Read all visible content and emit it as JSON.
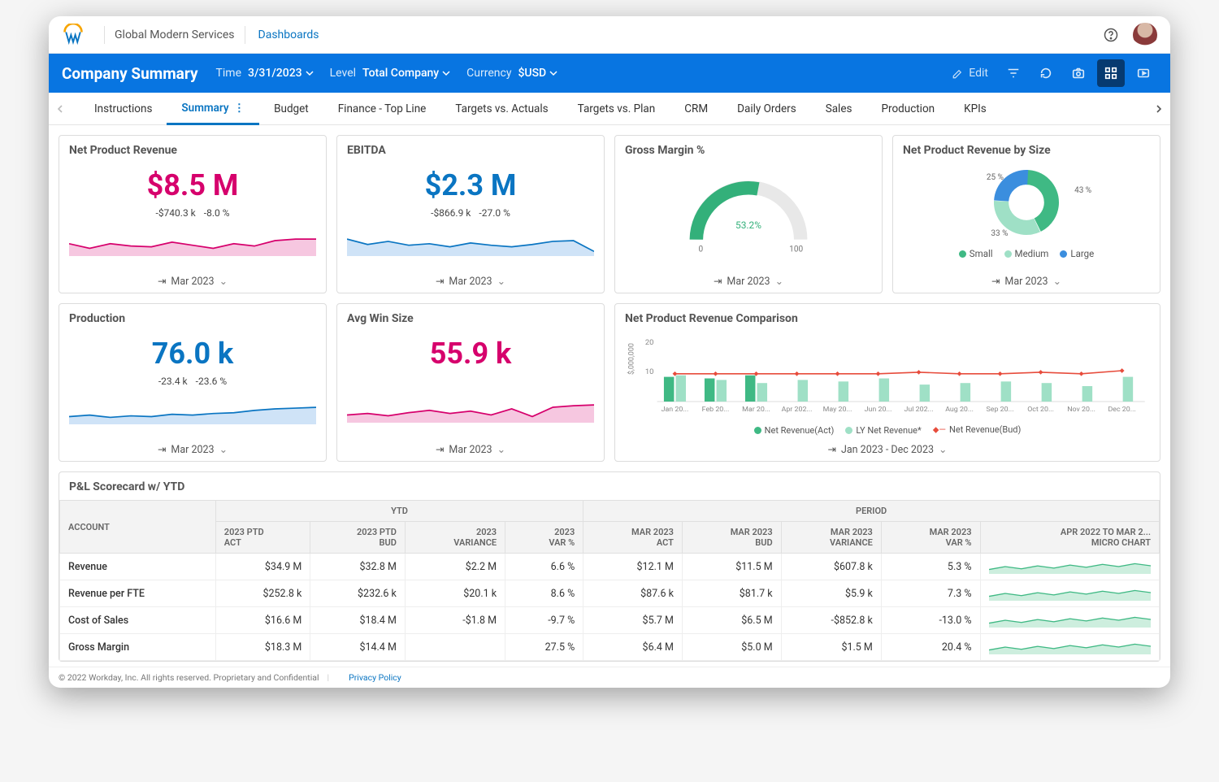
{
  "header": {
    "company": "Global Modern Services",
    "crumbLink": "Dashboards"
  },
  "bluebar": {
    "title": "Company Summary",
    "filters": {
      "time": {
        "label": "Time",
        "value": "3/31/2023"
      },
      "level": {
        "label": "Level",
        "value": "Total Company"
      },
      "currency": {
        "label": "Currency",
        "value": "$USD"
      }
    },
    "edit": "Edit"
  },
  "tabs": [
    "Instructions",
    "Summary",
    "Budget",
    "Finance - Top Line",
    "Targets vs. Actuals",
    "Targets vs. Plan",
    "CRM",
    "Daily Orders",
    "Sales",
    "Production",
    "KPIs"
  ],
  "activeTab": 1,
  "metrics": {
    "netProductRevenue": {
      "title": "Net Product Revenue",
      "value": "$8.5 M",
      "deltaAbs": "-$740.3 k",
      "deltaPct": "-8.0 %",
      "period": "Mar 2023"
    },
    "ebitda": {
      "title": "EBITDA",
      "value": "$2.3 M",
      "deltaAbs": "-$866.9 k",
      "deltaPct": "-27.0 %",
      "period": "Mar 2023"
    },
    "grossMargin": {
      "title": "Gross Margin %",
      "value": "53.2%",
      "scaleMin": "0",
      "scaleMax": "100",
      "period": "Mar 2023"
    },
    "bySize": {
      "title": "Net Product Revenue by Size",
      "period": "Mar 2023",
      "legend": [
        "Small",
        "Medium",
        "Large"
      ],
      "labels": {
        "small": "43 %",
        "medium": "33 %",
        "large": "25 %"
      }
    },
    "production": {
      "title": "Production",
      "value": "76.0 k",
      "deltaAbs": "-23.4 k",
      "deltaPct": "-23.6 %",
      "period": "Mar 2023"
    },
    "avgWin": {
      "title": "Avg Win Size",
      "value": "55.9 k",
      "period": "Mar 2023"
    },
    "comparison": {
      "title": "Net Product Revenue Comparison",
      "period": "Jan 2023 - Dec 2023",
      "yLabel": "$,000,000",
      "yTicks": [
        "20",
        "10"
      ],
      "legend": [
        "Net Revenue(Act)",
        "LY Net Revenue*",
        "Net Revenue(Bud)"
      ]
    }
  },
  "table": {
    "title": "P&L Scorecard w/ YTD",
    "groupHeaders": {
      "account": "ACCOUNT",
      "ytd": "YTD",
      "period": "PERIOD"
    },
    "cols": {
      "ytdAct": "2023 PTD\nACT",
      "ytdBud": "2023 PTD\nBUD",
      "ytdVar": "2023\nVARIANCE",
      "ytdVarPct": "2023\nVAR %",
      "pAct": "MAR 2023\nACT",
      "pBud": "MAR 2023\nBUD",
      "pVar": "MAR 2023\nVARIANCE",
      "pVarPct": "MAR 2023\nVAR %",
      "micro": "APR 2022 TO MAR 2...\nMICRO CHART"
    },
    "rows": [
      {
        "acct": "Revenue",
        "ytdAct": "$34.9 M",
        "ytdBud": "$32.8 M",
        "ytdVar": "$2.2 M",
        "ytdVarPct": "6.6 %",
        "pAct": "$12.1 M",
        "pBud": "$11.5 M",
        "pVar": "$607.8 k",
        "pVarPct": "5.3 %"
      },
      {
        "acct": "Revenue per FTE",
        "ytdAct": "$252.8 k",
        "ytdBud": "$232.6 k",
        "ytdVar": "$20.1 k",
        "ytdVarPct": "8.6 %",
        "pAct": "$87.6 k",
        "pBud": "$81.7 k",
        "pVar": "$5.9 k",
        "pVarPct": "7.3 %"
      },
      {
        "acct": "Cost of Sales",
        "ytdAct": "$16.6 M",
        "ytdBud": "$18.4 M",
        "ytdVar": "-$1.8 M",
        "ytdVarPct": "-9.7 %",
        "pAct": "$5.7 M",
        "pBud": "$6.5 M",
        "pVar": "-$852.8 k",
        "pVarPct": "-13.0 %"
      },
      {
        "acct": "Gross Margin",
        "ytdAct": "$18.3 M",
        "ytdBud": "$14.4 M",
        "ytdVar": "",
        "ytdVarPct": "27.5 %",
        "pAct": "$6.4 M",
        "pBud": "$5.0 M",
        "pVar": "$1.5 M",
        "pVarPct": "20.4 %"
      }
    ]
  },
  "footer": {
    "copyright": "© 2022 Workday, Inc. All rights reserved. Proprietary and Confidential",
    "privacy": "Privacy Policy"
  },
  "chart_data": [
    {
      "type": "area",
      "title": "Net Product Revenue spark",
      "x": [
        1,
        2,
        3,
        4,
        5,
        6,
        7,
        8,
        9,
        10,
        11,
        12
      ],
      "values": [
        8.6,
        8.0,
        8.5,
        8.3,
        8.2,
        8.8,
        8.4,
        8.0,
        8.6,
        8.3,
        9.0,
        9.2
      ]
    },
    {
      "type": "area",
      "title": "EBITDA spark",
      "x": [
        1,
        2,
        3,
        4,
        5,
        6,
        7,
        8,
        9,
        10,
        11,
        12
      ],
      "values": [
        3.0,
        2.5,
        2.8,
        2.4,
        2.6,
        2.3,
        2.7,
        2.5,
        2.4,
        2.6,
        2.9,
        1.6
      ]
    },
    {
      "type": "gauge",
      "title": "Gross Margin %",
      "value": 53.2,
      "min": 0,
      "max": 100
    },
    {
      "type": "pie",
      "title": "Net Product Revenue by Size",
      "categories": [
        "Small",
        "Medium",
        "Large"
      ],
      "values": [
        43,
        33,
        25
      ]
    },
    {
      "type": "area",
      "title": "Production spark",
      "x": [
        1,
        2,
        3,
        4,
        5,
        6,
        7,
        8,
        9,
        10,
        11,
        12
      ],
      "values": [
        70,
        72,
        69,
        71,
        70,
        73,
        72,
        74,
        75,
        78,
        80,
        82
      ]
    },
    {
      "type": "area",
      "title": "Avg Win Size spark",
      "x": [
        1,
        2,
        3,
        4,
        5,
        6,
        7,
        8,
        9,
        10,
        11,
        12
      ],
      "values": [
        50,
        52,
        49,
        53,
        56,
        52,
        55,
        50,
        58,
        48,
        60,
        62
      ]
    },
    {
      "type": "bar",
      "title": "Net Product Revenue Comparison",
      "ylabel": "$,000,000",
      "ylim": [
        0,
        20
      ],
      "categories": [
        "Jan 20...",
        "Feb 20...",
        "Mar 20...",
        "Apr 202...",
        "May 20...",
        "Jun 20...",
        "Jul 202...",
        "Aug 20...",
        "Sep 20...",
        "Oct 20...",
        "Nov 20...",
        "Dec 20..."
      ],
      "series": [
        {
          "name": "Net Revenue(Act)",
          "values": [
            8,
            7.5,
            8.5,
            0,
            0,
            0,
            0,
            0,
            0,
            0,
            0,
            0
          ]
        },
        {
          "name": "LY Net Revenue*",
          "values": [
            8.5,
            7,
            6,
            7,
            6.5,
            7.5,
            5.5,
            6,
            6.5,
            6,
            5,
            8
          ]
        },
        {
          "name": "Net Revenue(Bud)",
          "values": [
            9,
            9,
            9,
            9,
            9,
            9,
            9.5,
            9,
            9,
            9.5,
            9,
            10
          ]
        }
      ]
    }
  ]
}
